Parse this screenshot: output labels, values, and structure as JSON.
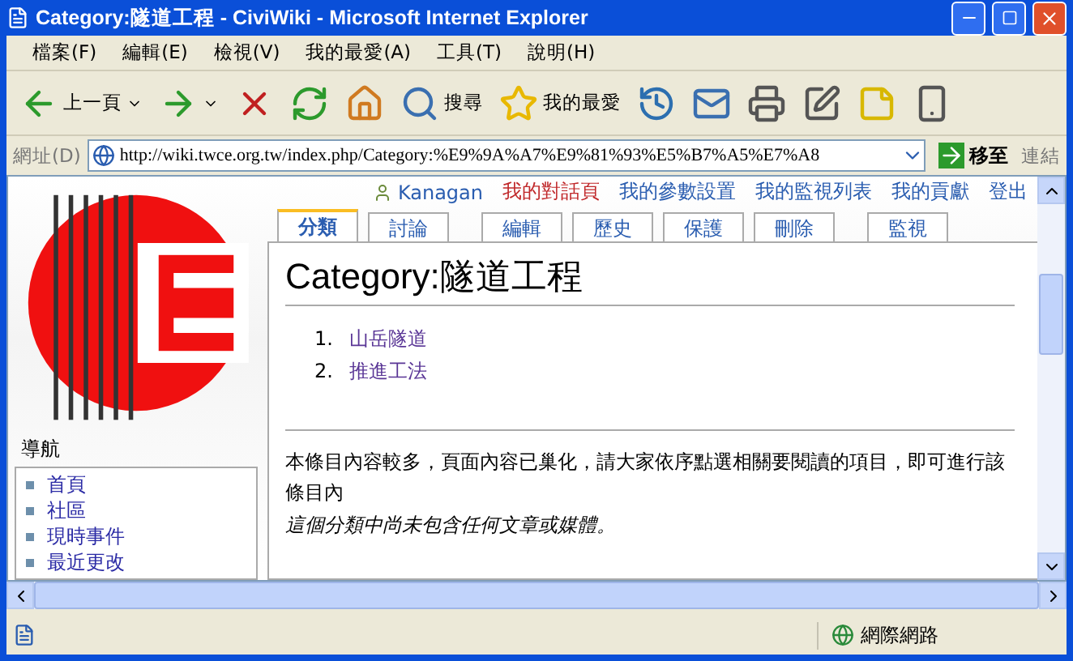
{
  "window": {
    "title": "Category:隧道工程 - CiviWiki - Microsoft Internet Explorer"
  },
  "menu": [
    "檔案(F)",
    "編輯(E)",
    "檢視(V)",
    "我的最愛(A)",
    "工具(T)",
    "說明(H)"
  ],
  "toolbar": [
    {
      "kind": "back",
      "label": "上一頁"
    },
    {
      "kind": "forward"
    },
    {
      "kind": "stop"
    },
    {
      "kind": "refresh"
    },
    {
      "kind": "home"
    },
    {
      "kind": "search",
      "label": "搜尋"
    },
    {
      "kind": "favorites",
      "label": "我的最愛"
    },
    {
      "kind": "history"
    },
    {
      "kind": "mail"
    },
    {
      "kind": "print"
    },
    {
      "kind": "edit"
    },
    {
      "kind": "note"
    },
    {
      "kind": "device"
    }
  ],
  "address": {
    "label": "網址(D)",
    "value": "http://wiki.twce.org.tw/index.php/Category:%E9%9A%A7%E9%81%93%E5%B7%A5%E7%A8",
    "go": "移至",
    "links": "連結"
  },
  "personal": [
    {
      "label": "Kanagan",
      "kind": "user",
      "missing": false
    },
    {
      "label": "我的對話頁",
      "kind": "link",
      "missing": true
    },
    {
      "label": "我的參數設置",
      "kind": "link",
      "missing": false
    },
    {
      "label": "我的監視列表",
      "kind": "link",
      "missing": false
    },
    {
      "label": "我的貢獻",
      "kind": "link",
      "missing": false
    },
    {
      "label": "登出",
      "kind": "link",
      "missing": false
    }
  ],
  "tabs": [
    {
      "label": "分類",
      "selected": true
    },
    {
      "label": "討論",
      "selected": false
    },
    {
      "label": "編輯",
      "selected": false
    },
    {
      "label": "歷史",
      "selected": false
    },
    {
      "label": "保護",
      "selected": false
    },
    {
      "label": "刪除",
      "selected": false
    },
    {
      "label": "監視",
      "selected": false
    }
  ],
  "heading": "Category:隧道工程",
  "list": [
    {
      "num": "1.",
      "label": "山岳隧道"
    },
    {
      "num": "2.",
      "label": "推進工法"
    }
  ],
  "notice": "本條目內容較多，頁面內容已巢化，請大家依序點選相關要閱讀的項目，即可進行該條目內",
  "empty_note": "這個分類中尚未包含任何文章或媒體。",
  "nav": {
    "title": "導航",
    "items": [
      "首頁",
      "社區",
      "現時事件",
      "最近更改"
    ]
  },
  "status_bar": {
    "zone": "網際網路"
  }
}
